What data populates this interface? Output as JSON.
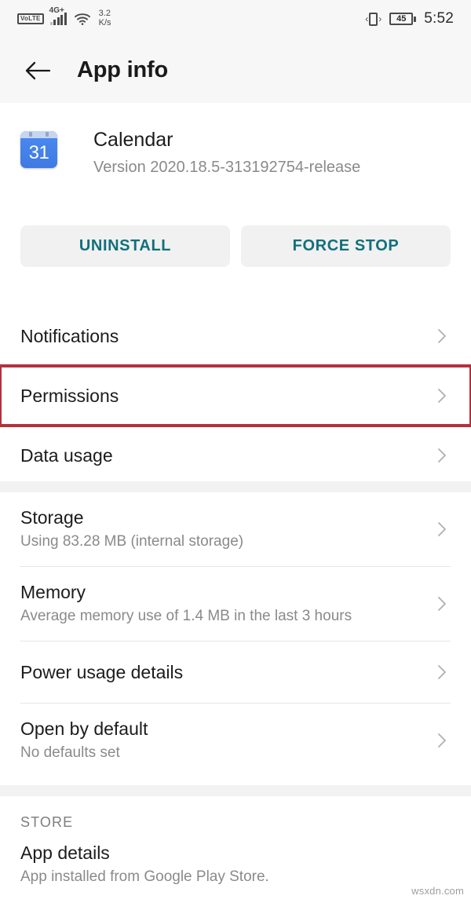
{
  "statusbar": {
    "volte_label": "VoLTE",
    "network_type": "4G+",
    "data_speed_value": "3.2",
    "data_speed_unit": "K/s",
    "battery_percent": "45",
    "clock": "5:52",
    "icons": {
      "signal": "signal-bars-icon",
      "wifi": "wifi-icon",
      "vibrate": "vibrate-icon",
      "battery": "battery-icon"
    }
  },
  "appbar": {
    "back_icon": "back-arrow-icon",
    "title": "App info"
  },
  "app": {
    "icon_day": "31",
    "name": "Calendar",
    "version": "Version 2020.18.5-313192754-release"
  },
  "actions": {
    "uninstall_label": "UNINSTALL",
    "force_stop_label": "FORCE STOP",
    "text_color": "#11707d",
    "bg_color": "#f1f1f1"
  },
  "highlight": {
    "color": "#b5303c",
    "target": "Permissions"
  },
  "list_primary": [
    {
      "title": "Notifications",
      "sub": ""
    },
    {
      "title": "Permissions",
      "sub": ""
    },
    {
      "title": "Data usage",
      "sub": ""
    }
  ],
  "list_secondary": [
    {
      "title": "Storage",
      "sub": "Using 83.28 MB (internal storage)"
    },
    {
      "title": "Memory",
      "sub": "Average memory use of 1.4 MB in the last 3 hours"
    },
    {
      "title": "Power usage details",
      "sub": ""
    },
    {
      "title": "Open by default",
      "sub": "No defaults set"
    }
  ],
  "store_section": {
    "label": "STORE",
    "items": [
      {
        "title": "App details",
        "sub": "App installed from Google Play Store."
      }
    ]
  },
  "watermark": "wsxdn.com"
}
